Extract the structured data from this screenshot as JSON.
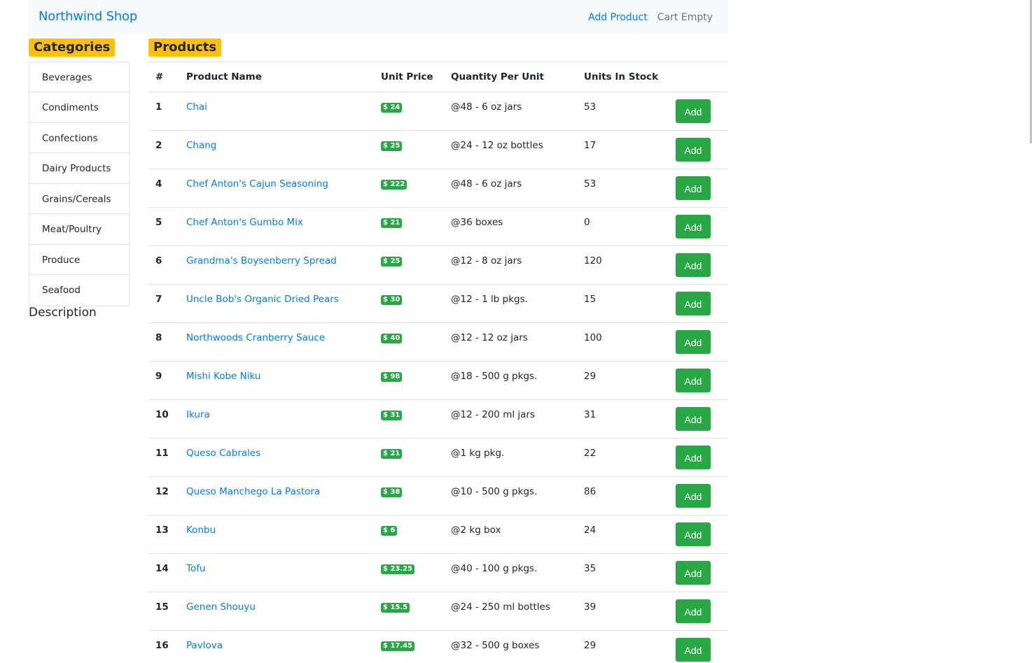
{
  "nav": {
    "brand": "Northwind Shop",
    "add_product": "Add Product",
    "cart": "Cart Empty"
  },
  "sidebar": {
    "heading": "Categories",
    "items": [
      {
        "label": "Beverages"
      },
      {
        "label": "Condiments"
      },
      {
        "label": "Confections"
      },
      {
        "label": "Dairy Products"
      },
      {
        "label": "Grains/Cereals"
      },
      {
        "label": "Meat/Poultry"
      },
      {
        "label": "Produce"
      },
      {
        "label": "Seafood"
      }
    ],
    "description_label": "Description"
  },
  "products": {
    "heading": "Products",
    "columns": [
      "#",
      "Product Name",
      "Unit Price",
      "Quantity Per Unit",
      "Units In Stock"
    ],
    "add_label": "Add",
    "rows": [
      {
        "id": "1",
        "name": "Chai",
        "price": "$ 24",
        "qty": "@48 - 6 oz jars",
        "stock": "53"
      },
      {
        "id": "2",
        "name": "Chang",
        "price": "$ 25",
        "qty": "@24 - 12 oz bottles",
        "stock": "17"
      },
      {
        "id": "4",
        "name": "Chef Anton's Cajun Seasoning",
        "price": "$ 222",
        "qty": "@48 - 6 oz jars",
        "stock": "53"
      },
      {
        "id": "5",
        "name": "Chef Anton's Gumbo Mix",
        "price": "$ 21",
        "qty": "@36 boxes",
        "stock": "0"
      },
      {
        "id": "6",
        "name": "Grandma's Boysenberry Spread",
        "price": "$ 25",
        "qty": "@12 - 8 oz jars",
        "stock": "120"
      },
      {
        "id": "7",
        "name": "Uncle Bob's Organic Dried Pears",
        "price": "$ 30",
        "qty": "@12 - 1 lb pkgs.",
        "stock": "15"
      },
      {
        "id": "8",
        "name": "Northwoods Cranberry Sauce",
        "price": "$ 40",
        "qty": "@12 - 12 oz jars",
        "stock": "100"
      },
      {
        "id": "9",
        "name": "Mishi Kobe Niku",
        "price": "$ 98",
        "qty": "@18 - 500 g pkgs.",
        "stock": "29"
      },
      {
        "id": "10",
        "name": "Ikura",
        "price": "$ 31",
        "qty": "@12 - 200 ml jars",
        "stock": "31"
      },
      {
        "id": "11",
        "name": "Queso Cabrales",
        "price": "$ 21",
        "qty": "@1 kg pkg.",
        "stock": "22"
      },
      {
        "id": "12",
        "name": "Queso Manchego La Pastora",
        "price": "$ 38",
        "qty": "@10 - 500 g pkgs.",
        "stock": "86"
      },
      {
        "id": "13",
        "name": "Konbu",
        "price": "$ 6",
        "qty": "@2 kg box",
        "stock": "24"
      },
      {
        "id": "14",
        "name": "Tofu",
        "price": "$ 23.25",
        "qty": "@40 - 100 g pkgs.",
        "stock": "35"
      },
      {
        "id": "15",
        "name": "Genen Shouyu",
        "price": "$ 15.5",
        "qty": "@24 - 250 ml bottles",
        "stock": "39"
      },
      {
        "id": "16",
        "name": "Pavlova",
        "price": "$ 17.45",
        "qty": "@32 - 500 g boxes",
        "stock": "29"
      }
    ]
  }
}
